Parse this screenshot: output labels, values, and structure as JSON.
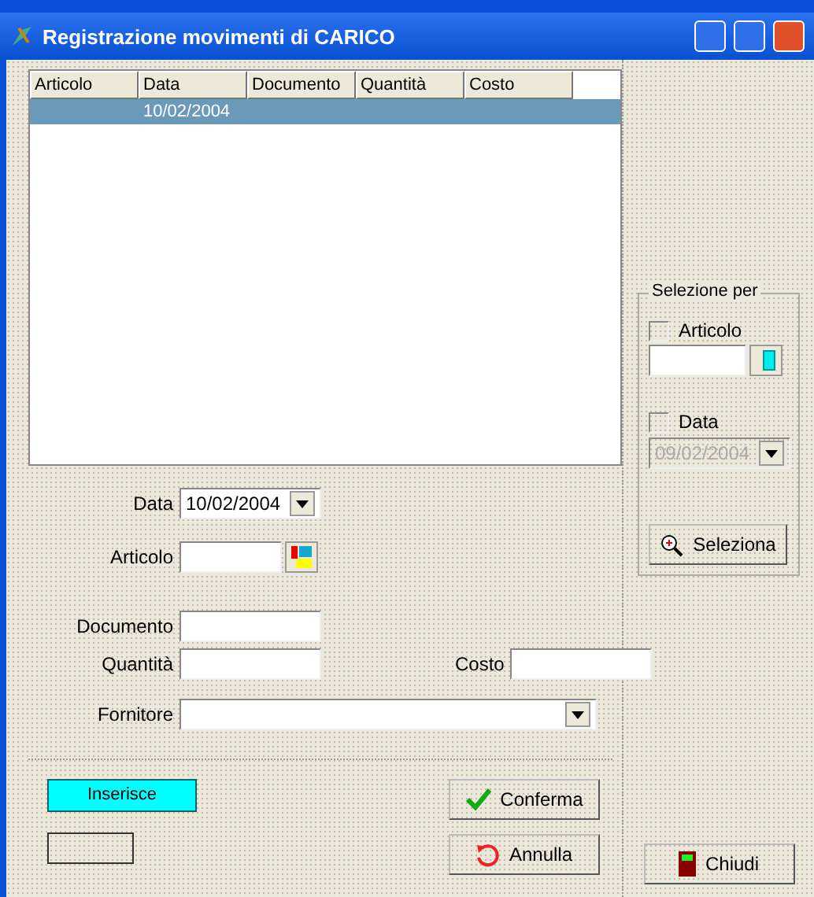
{
  "window": {
    "title": "Registrazione movimenti di CARICO"
  },
  "table": {
    "columns": [
      "Articolo",
      "Data",
      "Documento",
      "Quantità",
      "Costo"
    ],
    "rows": [
      {
        "selected": true,
        "data": "10/02/2004"
      }
    ]
  },
  "selection_panel": {
    "title": "Selezione per",
    "articolo": {
      "label": "Articolo",
      "checked": false
    },
    "data": {
      "label": "Data",
      "checked": false,
      "value": "09/02/2004",
      "disabled": true
    },
    "button": "Seleziona"
  },
  "form": {
    "data": {
      "label": "Data",
      "value": "10/02/2004"
    },
    "articolo": {
      "label": "Articolo"
    },
    "documento": {
      "label": "Documento"
    },
    "quantita": {
      "label": "Quantità"
    },
    "costo": {
      "label": "Costo"
    },
    "fornitore": {
      "label": "Fornitore"
    }
  },
  "mode_badge": "Inserisce",
  "buttons": {
    "confirm": "Conferma",
    "cancel": "Annulla",
    "close": "Chiudi"
  }
}
